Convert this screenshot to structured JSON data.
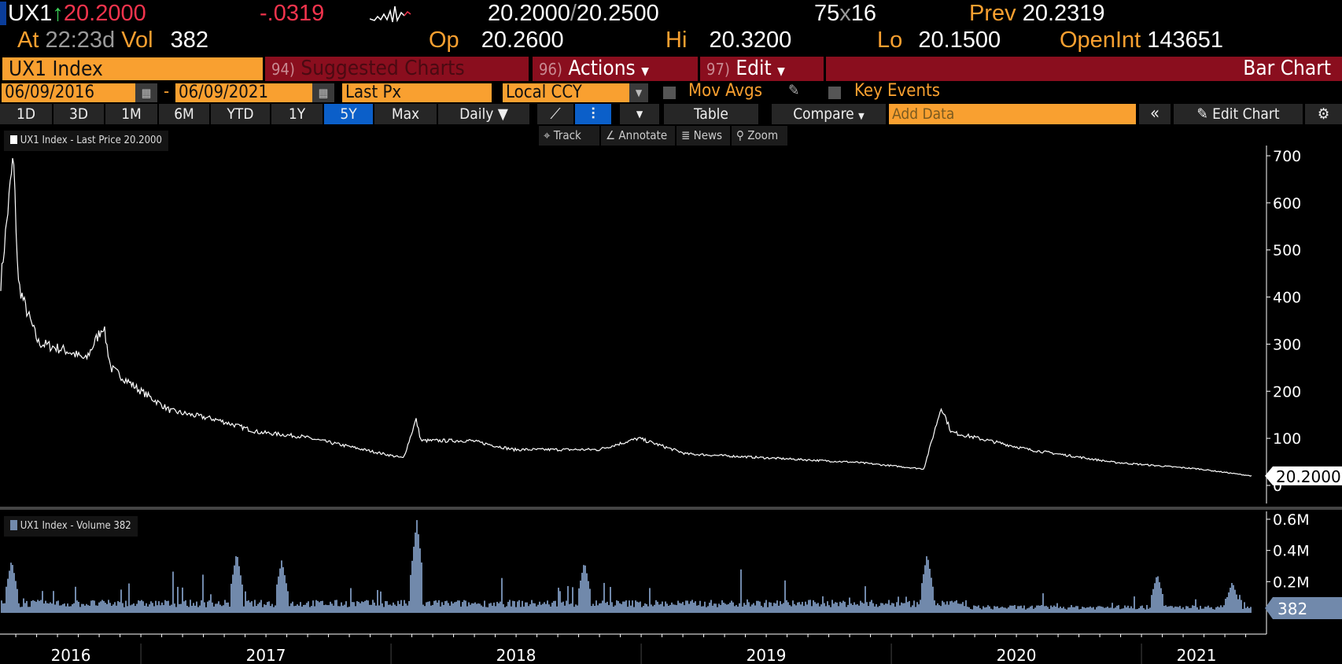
{
  "quote": {
    "ticker": "UX1",
    "last": "20.2000",
    "change": "-.0319",
    "bid": "20.2000",
    "ask": "20.2500",
    "size_bid": "75",
    "size_x": "x",
    "size_ask": "16",
    "prev_label": "Prev",
    "prev": "20.2319",
    "at_label": "At",
    "time": "22:23d",
    "vol_label": "Vol",
    "vol": "382",
    "op_label": "Op",
    "op": "20.2600",
    "hi_label": "Hi",
    "hi": "20.3200",
    "lo_label": "Lo",
    "lo": "20.1500",
    "oi_label": "OpenInt",
    "oi": "143651"
  },
  "menu": {
    "security": "UX1 Index",
    "suggested_num": "94)",
    "suggested": "Suggested Charts",
    "actions_num": "96)",
    "actions": "Actions",
    "edit_num": "97)",
    "edit": "Edit",
    "chart_type": "Bar Chart"
  },
  "settings": {
    "start_date": "06/09/2016",
    "dash": "-",
    "end_date": "06/09/2021",
    "field": "Last Px",
    "currency": "Local CCY",
    "mov_avgs": "Mov Avgs",
    "key_events": "Key Events"
  },
  "toolbar": {
    "periods": [
      "1D",
      "3D",
      "1M",
      "6M",
      "YTD",
      "1Y",
      "5Y",
      "Max"
    ],
    "active_period": "5Y",
    "frequency": "Daily ▼",
    "table": "Table",
    "compare": "Compare",
    "add_data_placeholder": "Add Data",
    "collapse": "«",
    "edit_chart": "Edit Chart"
  },
  "tools": {
    "track": "Track",
    "annotate": "Annotate",
    "news": "News",
    "zoom": "Zoom"
  },
  "colors": {
    "orange": "#f9a030",
    "red_bar": "#8a0e1e",
    "blue": "#0b5fc9",
    "volume": "#7189ab"
  },
  "chart_data": [
    {
      "type": "line",
      "title": "UX1 Index - Last Price 20.2000",
      "x_unit": "decimal year",
      "ylim": [
        0,
        750
      ],
      "yticks": [
        0,
        100,
        200,
        300,
        400,
        500,
        600,
        700
      ],
      "last_label": "20.2000",
      "x": [
        2016.44,
        2016.46,
        2016.49,
        2016.51,
        2016.54,
        2016.59,
        2016.71,
        2016.78,
        2016.85,
        2016.88,
        2016.99,
        2017.12,
        2017.3,
        2017.47,
        2017.64,
        2017.81,
        2018.05,
        2018.1,
        2018.12,
        2018.32,
        2018.49,
        2018.83,
        2018.99,
        2019.18,
        2019.52,
        2019.86,
        2020.13,
        2020.2,
        2020.24,
        2020.55,
        2020.89,
        2021.23,
        2021.44
      ],
      "values": [
        430,
        540,
        700,
        430,
        376,
        303,
        285,
        267,
        340,
        249,
        204,
        158,
        140,
        113,
        104,
        85,
        58,
        140,
        95,
        95,
        76,
        76,
        100,
        67,
        58,
        49,
        35,
        167,
        113,
        76,
        49,
        35,
        20.2
      ]
    },
    {
      "type": "bar",
      "title": "UX1 Index - Volume 382",
      "ylim": [
        0,
        650000
      ],
      "yticks": [
        {
          "v": 200000,
          "label": "0.2M"
        },
        {
          "v": 400000,
          "label": "0.4M"
        },
        {
          "v": 600000,
          "label": "0.6M"
        }
      ],
      "last_label": "382",
      "typical_value": 60000,
      "spikes_x": [
        2016.48,
        2017.38,
        2017.56,
        2018.1,
        2018.77,
        2020.14,
        2021.06,
        2021.36
      ],
      "spikes_values": [
        340000,
        390000,
        340000,
        600000,
        330000,
        380000,
        250000,
        200000
      ]
    },
    {
      "type": "axis",
      "x_labels": [
        "2016",
        "2017",
        "2018",
        "2019",
        "2020",
        "2021"
      ],
      "x_range": [
        2016.44,
        2021.44
      ]
    }
  ]
}
